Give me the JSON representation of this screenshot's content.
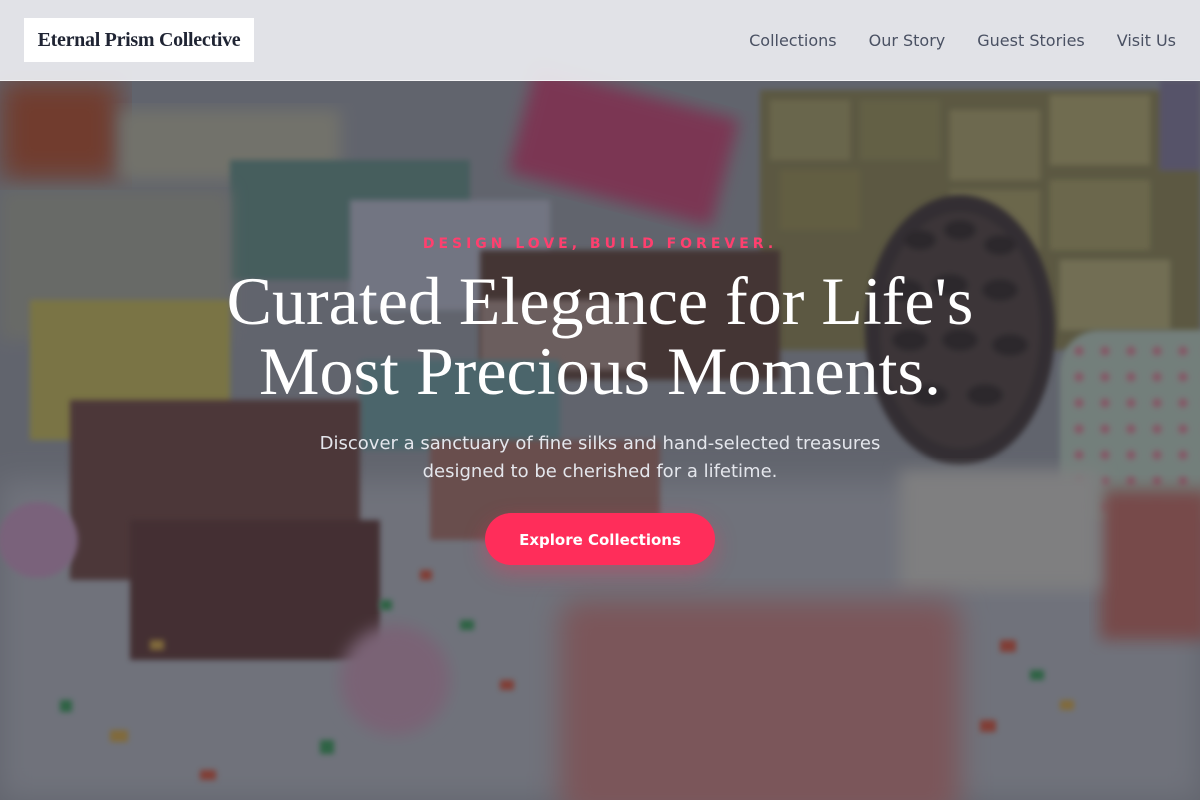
{
  "header": {
    "logo_text": "Eternal Prism Collective",
    "nav": [
      {
        "label": "Collections"
      },
      {
        "label": "Our Story"
      },
      {
        "label": "Guest Stories"
      },
      {
        "label": "Visit Us"
      }
    ]
  },
  "hero": {
    "eyebrow": "DESIGN LOVE, BUILD FOREVER.",
    "headline": "Curated Elegance for Life's Most Precious Moments.",
    "subtext": "Discover a sanctuary of fine silks and hand-selected treasures designed to be cherished for a lifetime.",
    "cta_label": "Explore Collections"
  },
  "colors": {
    "accent": "#ff2d5a",
    "eyebrow": "#ff3f6e",
    "header_bg": "#ebecf0",
    "logo_text": "#1f2433",
    "nav_text": "#4a5163"
  }
}
